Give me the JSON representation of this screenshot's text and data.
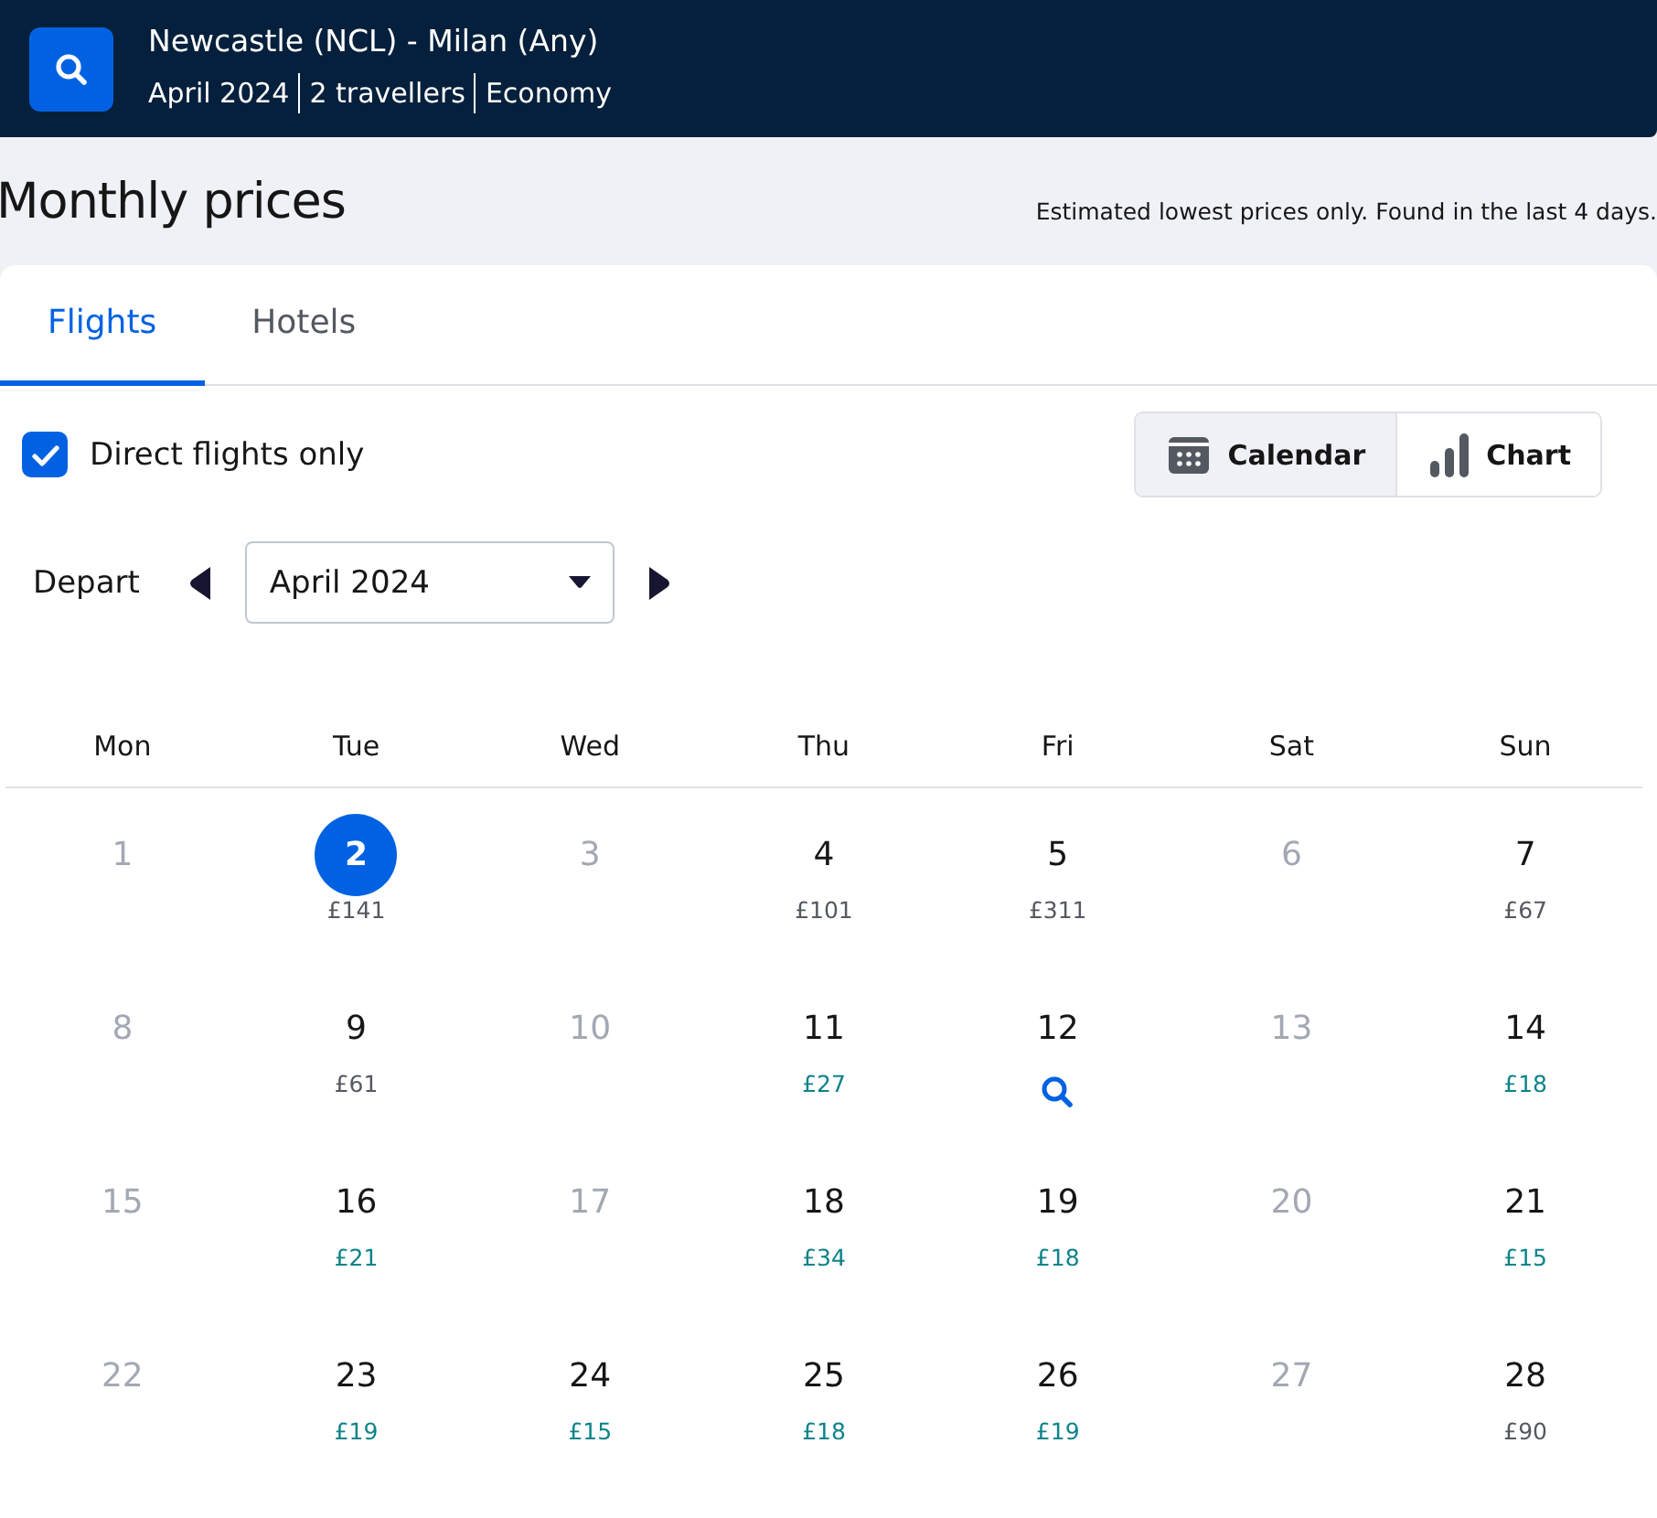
{
  "header": {
    "route": "Newcastle (NCL) - Milan (Any)",
    "details": [
      "April 2024",
      "2 travellers",
      "Economy"
    ]
  },
  "title": "Monthly prices",
  "note": "Estimated lowest prices only. Found in the last 4 days.",
  "tabs": [
    {
      "label": "Flights",
      "selected": true
    },
    {
      "label": "Hotels",
      "selected": false
    }
  ],
  "direct_only": {
    "label": "Direct flights only",
    "checked": true
  },
  "views": [
    {
      "label": "Calendar",
      "kind": "calendar",
      "selected": true
    },
    {
      "label": "Chart",
      "kind": "chart",
      "selected": false
    }
  ],
  "depart": {
    "label": "Depart",
    "month": "April 2024"
  },
  "weekdays": [
    "Mon",
    "Tue",
    "Wed",
    "Thu",
    "Fri",
    "Sat",
    "Sun"
  ],
  "days": [
    {
      "day": "1",
      "kind": "disabled"
    },
    {
      "day": "2",
      "kind": "priced",
      "price": "£141",
      "cheap": false,
      "selected": true
    },
    {
      "day": "3",
      "kind": "disabled"
    },
    {
      "day": "4",
      "kind": "priced",
      "price": "£101",
      "cheap": false,
      "selected": false
    },
    {
      "day": "5",
      "kind": "priced",
      "price": "£311",
      "cheap": false,
      "selected": false
    },
    {
      "day": "6",
      "kind": "disabled"
    },
    {
      "day": "7",
      "kind": "priced",
      "price": "£67",
      "cheap": false,
      "selected": false
    },
    {
      "day": "8",
      "kind": "disabled"
    },
    {
      "day": "9",
      "kind": "priced",
      "price": "£61",
      "cheap": false,
      "selected": false
    },
    {
      "day": "10",
      "kind": "disabled"
    },
    {
      "day": "11",
      "kind": "priced",
      "price": "£27",
      "cheap": true,
      "selected": false
    },
    {
      "day": "12",
      "kind": "search"
    },
    {
      "day": "13",
      "kind": "disabled"
    },
    {
      "day": "14",
      "kind": "priced",
      "price": "£18",
      "cheap": true,
      "selected": false
    },
    {
      "day": "15",
      "kind": "disabled"
    },
    {
      "day": "16",
      "kind": "priced",
      "price": "£21",
      "cheap": true,
      "selected": false
    },
    {
      "day": "17",
      "kind": "disabled"
    },
    {
      "day": "18",
      "kind": "priced",
      "price": "£34",
      "cheap": true,
      "selected": false
    },
    {
      "day": "19",
      "kind": "priced",
      "price": "£18",
      "cheap": true,
      "selected": false
    },
    {
      "day": "20",
      "kind": "disabled"
    },
    {
      "day": "21",
      "kind": "priced",
      "price": "£15",
      "cheap": true,
      "selected": false
    },
    {
      "day": "22",
      "kind": "disabled"
    },
    {
      "day": "23",
      "kind": "priced",
      "price": "£19",
      "cheap": true,
      "selected": false
    },
    {
      "day": "24",
      "kind": "priced",
      "price": "£15",
      "cheap": true,
      "selected": false
    },
    {
      "day": "25",
      "kind": "priced",
      "price": "£18",
      "cheap": true,
      "selected": false
    },
    {
      "day": "26",
      "kind": "priced",
      "price": "£19",
      "cheap": true,
      "selected": false
    },
    {
      "day": "27",
      "kind": "disabled"
    },
    {
      "day": "28",
      "kind": "priced",
      "price": "£90",
      "cheap": false,
      "selected": false
    }
  ]
}
